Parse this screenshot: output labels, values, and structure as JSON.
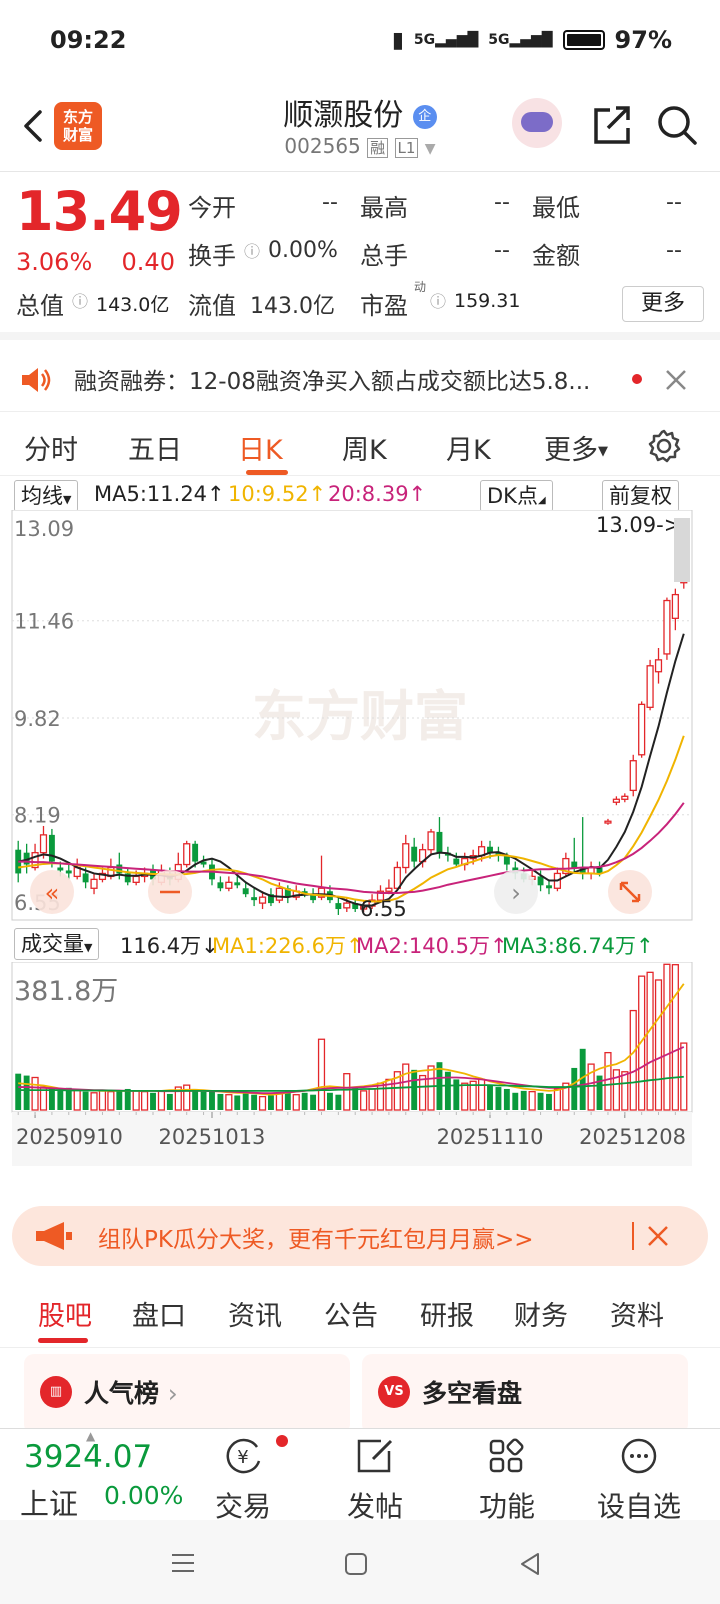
{
  "status_bar": {
    "time": "09:22",
    "battery": "97%",
    "network1": "5G",
    "network2": "5G"
  },
  "header": {
    "logo_line1": "东方",
    "logo_line2": "财富",
    "stock_name": "顺灏股份",
    "name_badge": "企",
    "stock_code": "002565",
    "badge_rong": "融",
    "badge_level": "L1"
  },
  "quote": {
    "price": "13.49",
    "change_pct": "3.06%",
    "change_amt": "0.40",
    "labels": {
      "open": "今开",
      "high": "最高",
      "low": "最低",
      "turnover": "换手",
      "volume": "总手",
      "amount": "金额",
      "total_mv": "总值",
      "float_mv": "流值",
      "pe": "市盈",
      "pe_sup": "动"
    },
    "values": {
      "open": "--",
      "high": "--",
      "low": "--",
      "turnover": "0.00%",
      "volume": "--",
      "amount": "--",
      "total_mv": "143.0亿",
      "float_mv": "143.0亿",
      "pe": "159.31"
    },
    "more_button": "更多"
  },
  "notice": {
    "text": "融资融券：12-08融资净买入额占成交额比达5.8..."
  },
  "kline_tabs": [
    {
      "label": "分时",
      "active": false
    },
    {
      "label": "五日",
      "active": false
    },
    {
      "label": "日K",
      "active": true
    },
    {
      "label": "周K",
      "active": false
    },
    {
      "label": "月K",
      "active": false
    },
    {
      "label": "更多",
      "active": false
    }
  ],
  "ma_bar": {
    "selector": "均线",
    "ma5": "MA5:11.24↑",
    "ma10": "10:9.52↑",
    "ma20": "20:8.39↑",
    "dk_button": "DK点",
    "adjust_button": "前复权"
  },
  "colors": {
    "up": "#e3262a",
    "down": "#0a9a3c",
    "ma5": "#222222",
    "ma10": "#f0b400",
    "ma20": "#c8237a",
    "accent": "#ee5a24"
  },
  "chart_data": {
    "type": "candlestick",
    "price_axis": [
      "13.09",
      "11.46",
      "9.82",
      "8.19",
      "6.55"
    ],
    "max_label": "13.09->",
    "min_label": "6.55",
    "watermark": "东方财富",
    "candles": [
      [
        7.6,
        7.2,
        7.75,
        7.05
      ],
      [
        7.55,
        7.35,
        7.7,
        7.2
      ],
      [
        7.3,
        7.55,
        7.7,
        7.25
      ],
      [
        7.55,
        7.85,
        8.0,
        7.45
      ],
      [
        7.85,
        7.4,
        7.95,
        7.3
      ],
      [
        7.3,
        7.25,
        7.4,
        7.15
      ],
      [
        7.25,
        7.2,
        7.35,
        7.1
      ],
      [
        7.15,
        7.3,
        7.45,
        7.1
      ],
      [
        7.2,
        7.05,
        7.3,
        6.95
      ],
      [
        6.95,
        7.1,
        7.2,
        6.85
      ],
      [
        7.1,
        7.2,
        7.3,
        7.05
      ],
      [
        7.15,
        7.3,
        7.45,
        7.1
      ],
      [
        7.35,
        7.2,
        7.55,
        7.1
      ],
      [
        7.2,
        7.05,
        7.3,
        7.0
      ],
      [
        7.05,
        7.15,
        7.25,
        7.0
      ],
      [
        7.15,
        7.2,
        7.3,
        7.05
      ],
      [
        7.25,
        7.1,
        7.35,
        7.0
      ],
      [
        7.05,
        7.25,
        7.35,
        7.0
      ],
      [
        7.2,
        7.1,
        7.3,
        7.0
      ],
      [
        7.1,
        7.35,
        7.55,
        7.05
      ],
      [
        7.35,
        7.7,
        7.75,
        7.3
      ],
      [
        7.7,
        7.4,
        7.75,
        7.3
      ],
      [
        7.4,
        7.35,
        7.5,
        7.3
      ],
      [
        7.35,
        7.1,
        7.45,
        7.0
      ],
      [
        7.05,
        6.95,
        7.15,
        6.9
      ],
      [
        6.95,
        7.05,
        7.15,
        6.9
      ],
      [
        7.05,
        7.0,
        7.15,
        6.95
      ],
      [
        6.95,
        6.85,
        7.05,
        6.8
      ],
      [
        6.8,
        6.75,
        6.95,
        6.65
      ],
      [
        6.7,
        6.8,
        6.9,
        6.6
      ],
      [
        6.85,
        6.7,
        6.95,
        6.65
      ],
      [
        6.75,
        6.95,
        7.05,
        6.7
      ],
      [
        6.95,
        6.8,
        7.0,
        6.7
      ],
      [
        6.8,
        6.9,
        7.0,
        6.75
      ],
      [
        6.9,
        6.85,
        6.95,
        6.8
      ],
      [
        6.85,
        6.75,
        6.95,
        6.7
      ],
      [
        6.8,
        6.95,
        7.5,
        6.75
      ],
      [
        6.9,
        6.75,
        7.0,
        6.7
      ],
      [
        6.7,
        6.6,
        6.8,
        6.5
      ],
      [
        6.62,
        6.7,
        6.8,
        6.55
      ],
      [
        6.7,
        6.6,
        6.75,
        6.55
      ],
      [
        6.6,
        6.65,
        6.75,
        6.55
      ],
      [
        6.65,
        6.75,
        6.85,
        6.6
      ],
      [
        6.75,
        6.9,
        7.0,
        6.7
      ],
      [
        6.9,
        6.95,
        7.1,
        6.85
      ],
      [
        6.95,
        7.3,
        7.4,
        6.9
      ],
      [
        7.3,
        7.7,
        7.85,
        7.2
      ],
      [
        7.65,
        7.4,
        7.8,
        7.3
      ],
      [
        7.4,
        7.6,
        7.7,
        7.3
      ],
      [
        7.6,
        7.9,
        7.95,
        7.5
      ],
      [
        7.9,
        7.55,
        8.15,
        7.45
      ],
      [
        7.55,
        7.5,
        7.65,
        7.4
      ],
      [
        7.45,
        7.35,
        7.55,
        7.3
      ],
      [
        7.35,
        7.45,
        7.55,
        7.25
      ],
      [
        7.45,
        7.5,
        7.6,
        7.35
      ],
      [
        7.5,
        7.65,
        7.75,
        7.4
      ],
      [
        7.65,
        7.55,
        7.75,
        7.45
      ],
      [
        7.55,
        7.5,
        7.65,
        7.4
      ],
      [
        7.5,
        7.35,
        7.55,
        7.25
      ],
      [
        7.3,
        7.2,
        7.4,
        7.1
      ],
      [
        7.2,
        7.1,
        7.3,
        7.05
      ],
      [
        7.1,
        7.15,
        7.25,
        7.0
      ],
      [
        7.15,
        7.0,
        7.25,
        6.9
      ],
      [
        7.0,
        6.95,
        7.1,
        6.85
      ],
      [
        6.95,
        7.2,
        7.3,
        6.9
      ],
      [
        7.2,
        7.45,
        7.55,
        7.15
      ],
      [
        7.4,
        7.3,
        7.8,
        7.2
      ],
      [
        7.3,
        7.2,
        8.15,
        7.1
      ],
      [
        7.2,
        7.3,
        7.4,
        7.1
      ],
      [
        7.3,
        7.2,
        7.4,
        7.15
      ],
      [
        8.05,
        8.08,
        8.12,
        8.02
      ],
      [
        8.4,
        8.45,
        8.5,
        8.35
      ],
      [
        8.45,
        8.5,
        8.55,
        8.4
      ],
      [
        8.6,
        9.1,
        9.2,
        8.5
      ],
      [
        9.2,
        10.05,
        10.1,
        9.15
      ],
      [
        10.0,
        10.7,
        10.8,
        9.95
      ],
      [
        10.6,
        10.8,
        11.0,
        10.4
      ],
      [
        10.9,
        11.8,
        11.85,
        10.8
      ],
      [
        11.5,
        11.9,
        12.0,
        11.3
      ],
      [
        12.1,
        13.0,
        13.09,
        12.0
      ]
    ],
    "ma5_values": [
      7.4,
      7.43,
      7.48,
      7.52,
      7.5,
      7.45,
      7.38,
      7.3,
      7.25,
      7.2,
      7.18,
      7.16,
      7.18,
      7.16,
      7.16,
      7.18,
      7.18,
      7.17,
      7.14,
      7.18,
      7.25,
      7.35,
      7.42,
      7.45,
      7.4,
      7.3,
      7.17,
      7.05,
      6.96,
      6.88,
      6.82,
      6.81,
      6.8,
      6.83,
      6.84,
      6.85,
      6.85,
      6.84,
      6.8,
      6.74,
      6.69,
      6.66,
      6.66,
      6.72,
      6.77,
      6.92,
      7.13,
      7.27,
      7.4,
      7.52,
      7.55,
      7.54,
      7.48,
      7.48,
      7.47,
      7.5,
      7.55,
      7.56,
      7.51,
      7.45,
      7.36,
      7.27,
      7.17,
      7.08,
      7.08,
      7.15,
      7.22,
      7.27,
      7.31,
      7.29,
      7.43,
      7.65,
      7.9,
      8.24,
      8.66,
      9.18,
      9.68,
      10.25,
      10.78,
      11.24
    ],
    "ma10_values": [
      7.3,
      7.32,
      7.34,
      7.36,
      7.37,
      7.37,
      7.36,
      7.34,
      7.32,
      7.3,
      7.28,
      7.26,
      7.24,
      7.22,
      7.21,
      7.2,
      7.19,
      7.19,
      7.18,
      7.18,
      7.19,
      7.21,
      7.24,
      7.26,
      7.27,
      7.26,
      7.24,
      7.2,
      7.15,
      7.1,
      7.03,
      6.98,
      6.93,
      6.9,
      6.86,
      6.84,
      6.83,
      6.82,
      6.81,
      6.79,
      6.76,
      6.74,
      6.73,
      6.73,
      6.74,
      6.78,
      6.86,
      6.94,
      7.03,
      7.13,
      7.2,
      7.27,
      7.31,
      7.36,
      7.4,
      7.45,
      7.49,
      7.51,
      7.5,
      7.48,
      7.45,
      7.41,
      7.37,
      7.32,
      7.28,
      7.24,
      7.21,
      7.2,
      7.2,
      7.19,
      7.24,
      7.34,
      7.46,
      7.66,
      7.89,
      8.16,
      8.44,
      8.76,
      9.12,
      9.52
    ],
    "ma20_values": [
      7.4,
      7.4,
      7.39,
      7.39,
      7.38,
      7.37,
      7.36,
      7.35,
      7.34,
      7.33,
      7.32,
      7.31,
      7.3,
      7.29,
      7.28,
      7.27,
      7.26,
      7.25,
      7.24,
      7.24,
      7.23,
      7.23,
      7.23,
      7.23,
      7.22,
      7.21,
      7.2,
      7.19,
      7.17,
      7.15,
      7.12,
      7.09,
      7.06,
      7.03,
      7.01,
      6.99,
      6.97,
      6.95,
      6.94,
      6.93,
      6.91,
      6.89,
      6.88,
      6.87,
      6.87,
      6.87,
      6.88,
      6.89,
      6.91,
      6.94,
      6.97,
      7.01,
      7.04,
      7.07,
      7.1,
      7.13,
      7.16,
      7.19,
      7.22,
      7.24,
      7.25,
      7.26,
      7.27,
      7.27,
      7.28,
      7.28,
      7.29,
      7.3,
      7.3,
      7.31,
      7.34,
      7.39,
      7.45,
      7.53,
      7.63,
      7.75,
      7.88,
      8.03,
      8.2,
      8.39
    ],
    "volume": {
      "label": "成交量",
      "current": "116.4万↓",
      "ma1": "MA1:226.6万↑",
      "ma2": "MA2:140.5万↑",
      "ma3": "MA3:86.74万↑",
      "max_label": "381.8万",
      "bars": [
        95,
        90,
        85,
        60,
        55,
        50,
        58,
        52,
        48,
        45,
        50,
        48,
        52,
        55,
        50,
        48,
        45,
        50,
        42,
        60,
        65,
        55,
        48,
        50,
        42,
        40,
        38,
        45,
        40,
        35,
        38,
        42,
        48,
        40,
        45,
        40,
        185,
        45,
        40,
        95,
        60,
        50,
        55,
        70,
        80,
        100,
        120,
        105,
        90,
        115,
        125,
        100,
        80,
        70,
        75,
        80,
        65,
        60,
        55,
        45,
        50,
        48,
        45,
        42,
        55,
        70,
        110,
        160,
        120,
        90,
        150,
        105,
        100,
        260,
        350,
        360,
        340,
        381,
        380,
        175
      ],
      "ma1_line": [
        70,
        68,
        66,
        64,
        60,
        56,
        54,
        52,
        52,
        51,
        50,
        50,
        50,
        50,
        50,
        50,
        50,
        50,
        52,
        52,
        53,
        53,
        52,
        50,
        48,
        46,
        45,
        45,
        44,
        42,
        40,
        42,
        45,
        48,
        50,
        55,
        60,
        62,
        60,
        58,
        60,
        62,
        65,
        70,
        78,
        85,
        95,
        100,
        103,
        105,
        108,
        105,
        100,
        95,
        88,
        82,
        75,
        70,
        64,
        60,
        56,
        54,
        52,
        50,
        52,
        58,
        70,
        85,
        98,
        108,
        115,
        120,
        130,
        150,
        180,
        210,
        240,
        270,
        300,
        330
      ],
      "ma2_line": [
        60,
        60,
        59,
        58,
        57,
        56,
        55,
        54,
        53,
        52,
        52,
        51,
        51,
        50,
        50,
        50,
        50,
        49,
        49,
        49,
        50,
        50,
        50,
        49,
        49,
        48,
        47,
        46,
        45,
        44,
        44,
        45,
        46,
        48,
        50,
        52,
        55,
        57,
        58,
        58,
        59,
        60,
        62,
        64,
        67,
        70,
        74,
        78,
        80,
        82,
        84,
        85,
        85,
        84,
        82,
        80,
        77,
        74,
        71,
        68,
        65,
        62,
        60,
        58,
        58,
        59,
        62,
        66,
        70,
        75,
        80,
        85,
        92,
        100,
        112,
        125,
        135,
        145,
        155,
        165
      ],
      "ma3_line": [
        52,
        52,
        52,
        52,
        52,
        52,
        51,
        51,
        51,
        51,
        51,
        51,
        50,
        50,
        50,
        50,
        50,
        50,
        50,
        50,
        50,
        50,
        50,
        50,
        50,
        50,
        50,
        50,
        50,
        50,
        50,
        50,
        50,
        50,
        51,
        51,
        52,
        52,
        53,
        53,
        54,
        55,
        55,
        56,
        57,
        58,
        59,
        60,
        61,
        62,
        63,
        64,
        64,
        65,
        65,
        65,
        65,
        64,
        64,
        63,
        62,
        62,
        61,
        60,
        60,
        60,
        61,
        62,
        63,
        64,
        66,
        68,
        70,
        72,
        75,
        78,
        80,
        83,
        85,
        87
      ],
      "dates": [
        "20250910",
        "20251013",
        "20251110",
        "20251208"
      ]
    }
  },
  "promo": {
    "text": "组队PK瓜分大奖，更有千元红包月月赢>>"
  },
  "bottom_tabs": [
    {
      "label": "股吧",
      "active": true
    },
    {
      "label": "盘口",
      "active": false
    },
    {
      "label": "资讯",
      "active": false
    },
    {
      "label": "公告",
      "active": false
    },
    {
      "label": "研报",
      "active": false
    },
    {
      "label": "财务",
      "active": false
    },
    {
      "label": "资料",
      "active": false
    }
  ],
  "cards": {
    "popular": "人气榜",
    "longshort": "多空看盘",
    "longshort_icon": "VS"
  },
  "bottom_nav": {
    "index_value": "3924.07",
    "index_name": "上证",
    "index_change": "0.00%",
    "items": [
      {
        "label": "交易"
      },
      {
        "label": "发帖"
      },
      {
        "label": "功能"
      },
      {
        "label": "设自选"
      }
    ]
  }
}
